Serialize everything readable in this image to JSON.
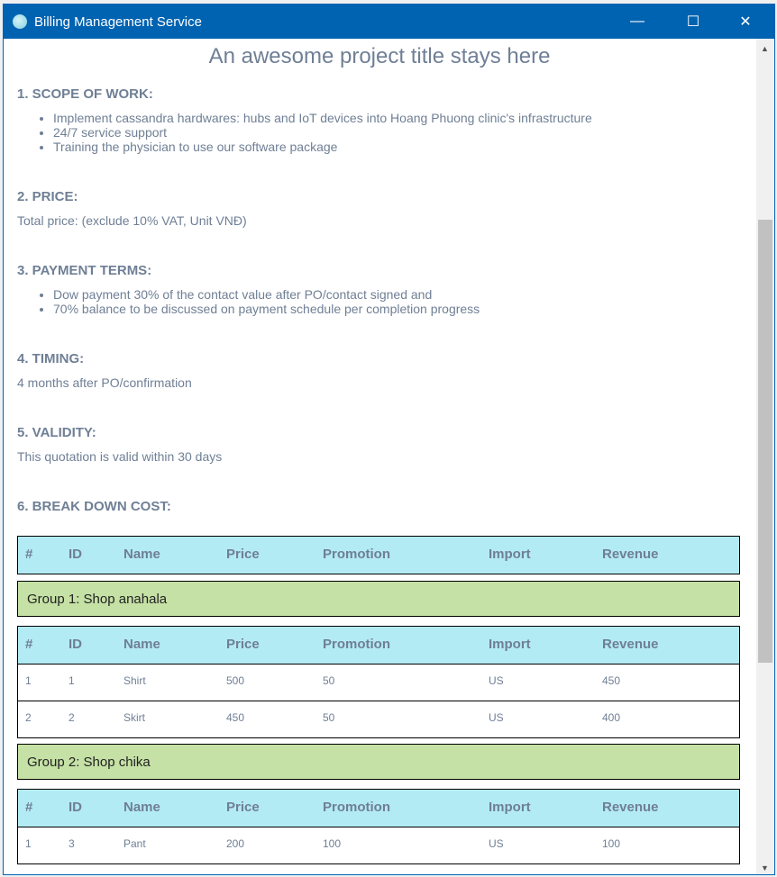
{
  "window": {
    "title": "Billing Management Service",
    "minimize": "—",
    "maximize": "☐",
    "close": "✕"
  },
  "doc": {
    "title": "An awesome project title stays here",
    "s1": {
      "heading": "1. SCOPE OF WORK:",
      "items": [
        "Implement cassandra hardwares: hubs and IoT devices into Hoang Phuong clinic's infrastructure",
        "24/7 service support",
        "Training the physician to use our software package"
      ]
    },
    "s2": {
      "heading": "2. PRICE:",
      "text": "Total price: (exclude 10% VAT, Unit VNĐ)"
    },
    "s3": {
      "heading": "3. PAYMENT TERMS:",
      "items": [
        "Dow payment 30% of the contact value after PO/contact signed and",
        "70% balance to be discussed on payment schedule per completion progress"
      ]
    },
    "s4": {
      "heading": "4. TIMING:",
      "text": "4 months after PO/confirmation"
    },
    "s5": {
      "heading": "5. VALIDITY:",
      "text": "This quotation is valid within 30 days"
    },
    "s6": {
      "heading": "6. BREAK DOWN COST:"
    }
  },
  "table": {
    "columns": [
      "#",
      "ID",
      "Name",
      "Price",
      "Promotion",
      "Import",
      "Revenue"
    ],
    "groups": [
      {
        "label": "Group 1: Shop anahala",
        "rows": [
          [
            "1",
            "1",
            "Shirt",
            "500",
            "50",
            "US",
            "450"
          ],
          [
            "2",
            "2",
            "Skirt",
            "450",
            "50",
            "US",
            "400"
          ]
        ]
      },
      {
        "label": "Group 2: Shop chika",
        "rows": [
          [
            "1",
            "3",
            "Pant",
            "200",
            "100",
            "US",
            "100"
          ]
        ]
      }
    ]
  },
  "colors": {
    "titlebar": "#0063b1",
    "header": "#b3ebf4",
    "group": "#c5e1a5",
    "text": "#6f7f95"
  }
}
